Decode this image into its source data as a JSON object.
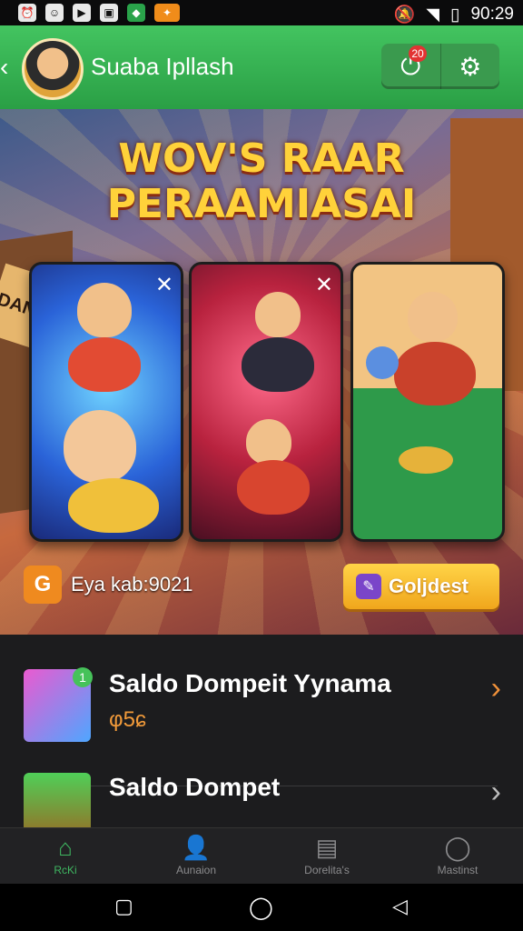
{
  "status": {
    "time": "90:29",
    "left_icons": [
      "alarm-icon",
      "face-icon",
      "play-icon",
      "bag-icon",
      "game-icon",
      "app-icon"
    ]
  },
  "header": {
    "title": "Suaba Ipllash",
    "notification_count": "20"
  },
  "banner": {
    "headline_line1": "WOV'S RAAR",
    "headline_line2": "PERAAMIASAI",
    "shop_sign": "DANGE",
    "footer_text": "Eya kab:9021",
    "footer_icon_letter": "G",
    "gold_button": "Goljdest"
  },
  "list": {
    "items": [
      {
        "title": "Saldo Dompeit Yynama",
        "subtitle": "φ5ɕ",
        "badge": "1",
        "chevron_color": "#f0913a"
      },
      {
        "title": "Saldo Dompet",
        "subtitle": "",
        "chevron_color": "#bdbdbd"
      }
    ]
  },
  "tabs": [
    {
      "label": "RcKi",
      "icon": "home-icon",
      "active": true
    },
    {
      "label": "Aunaion",
      "icon": "person-icon",
      "active": false
    },
    {
      "label": "Dorelita's",
      "icon": "document-icon",
      "active": false
    },
    {
      "label": "Mastinst",
      "icon": "profile-icon",
      "active": false
    }
  ]
}
